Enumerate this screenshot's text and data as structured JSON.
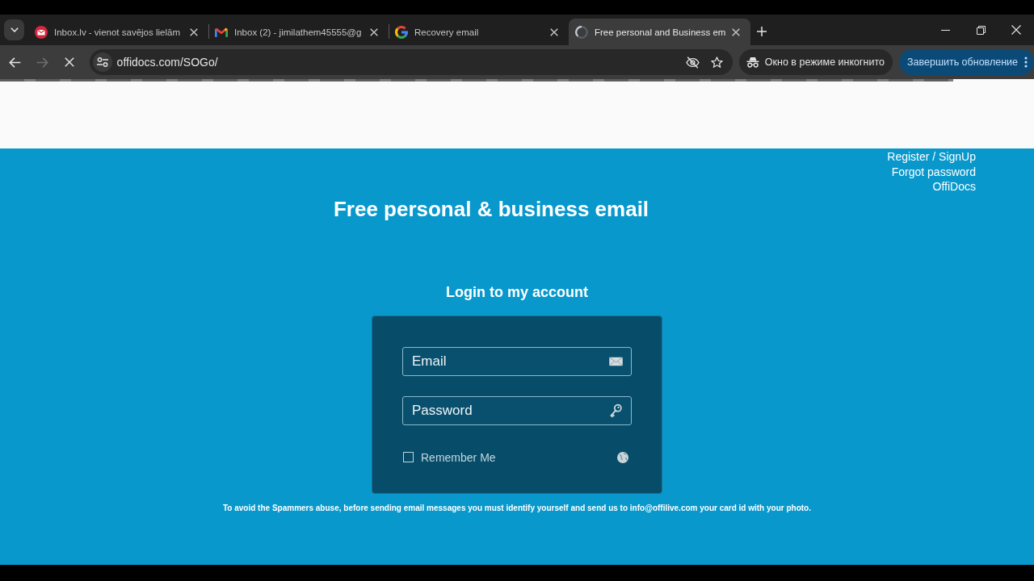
{
  "browser": {
    "tabs": [
      {
        "kind": "envelope",
        "title": "Inbox.lv - vienot savējos lielām",
        "selected": false
      },
      {
        "kind": "m-logo",
        "title": "Inbox (2) - jimilathem45555@g",
        "selected": false
      },
      {
        "kind": "g-logo",
        "title": "Recovery email",
        "selected": false
      },
      {
        "kind": "loading",
        "title": "Free personal and Business em",
        "selected": true
      }
    ],
    "nav_buttons": [
      {
        "kind": "back",
        "disabled": false
      },
      {
        "kind": "forward",
        "disabled": true
      },
      {
        "kind": "stop",
        "disabled": false
      }
    ],
    "address_bar": {
      "url": "offidocs.com/SOGo/"
    },
    "incognito_label": "Окно в режиме инкогнито",
    "update_button": "Завершить обновление"
  },
  "page": {
    "links": [
      "Register / SignUp",
      "Forgot password",
      "OffiDocs"
    ],
    "title": "Free personal & business email",
    "login": {
      "heading": "Login to my account",
      "fields": [
        {
          "kind": "email",
          "placeholder": "Email"
        },
        {
          "kind": "password",
          "placeholder": "Password"
        }
      ],
      "remember": {
        "label": "Remember Me",
        "checked": false
      }
    },
    "notice": "To avoid the Spammers abuse, before sending email messages you must identify yourself and send us to info@offilive.com your card id with your photo."
  }
}
